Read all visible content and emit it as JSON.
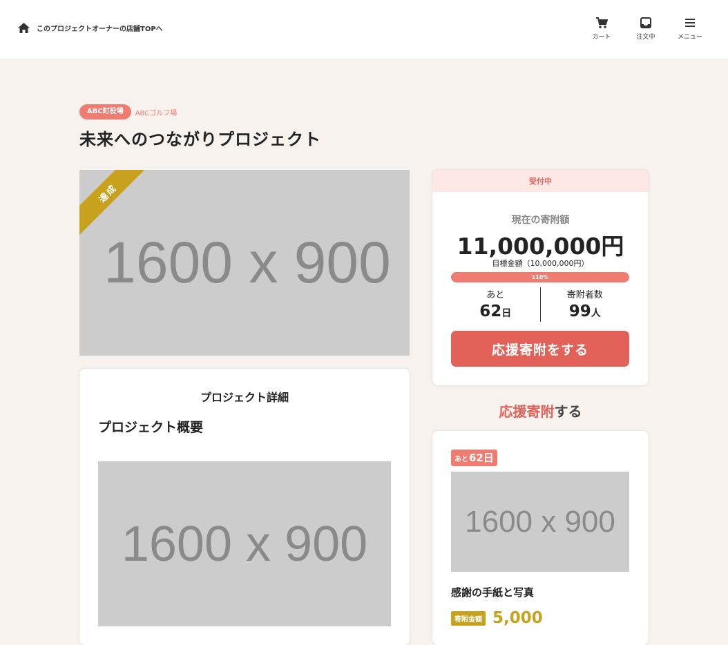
{
  "header": {
    "home_link_label": "このプロジェクトオーナーの店舗TOPへ",
    "nav": [
      {
        "label": "カート",
        "icon": "cart-icon"
      },
      {
        "label": "注文中",
        "icon": "inbox-icon"
      },
      {
        "label": "メニュー",
        "icon": "menu-icon"
      }
    ]
  },
  "project": {
    "municipality_tag": "ABC町役場",
    "owner_name": "ABCゴルフ場",
    "title": "未来へのつながりプロジェクト",
    "main_image_text": "1600 x 900",
    "ribbon_label": "達成"
  },
  "details": {
    "heading": "プロジェクト詳細",
    "overview_heading": "プロジェクト概要",
    "image_text": "1600 x 900"
  },
  "status": {
    "state_label": "受付中",
    "current_label": "現在の寄附額",
    "current_amount": "11,000,000円",
    "goal_text": "目標金額（10,000,000円）",
    "progress_label": "110%",
    "progress_fraction": 1.0,
    "remaining_label": "あと",
    "remaining_value": "62",
    "remaining_unit": "日",
    "donors_label": "寄附者数",
    "donors_value": "99",
    "donors_unit": "人",
    "donate_button": "応援寄附をする"
  },
  "support_section": {
    "heading_accent": "応援寄附",
    "heading_rest": "する"
  },
  "reward": {
    "badge_prefix": "あと",
    "badge_days": "62日",
    "image_text": "1600 x 900",
    "title": "感謝の手紙と写真",
    "price_label": "寄附金額",
    "price_value": "5,000"
  },
  "colors": {
    "accent": "#e2625a",
    "accent_light": "#ef7b71",
    "gold": "#c8a21c",
    "background": "#f8f2ee"
  }
}
